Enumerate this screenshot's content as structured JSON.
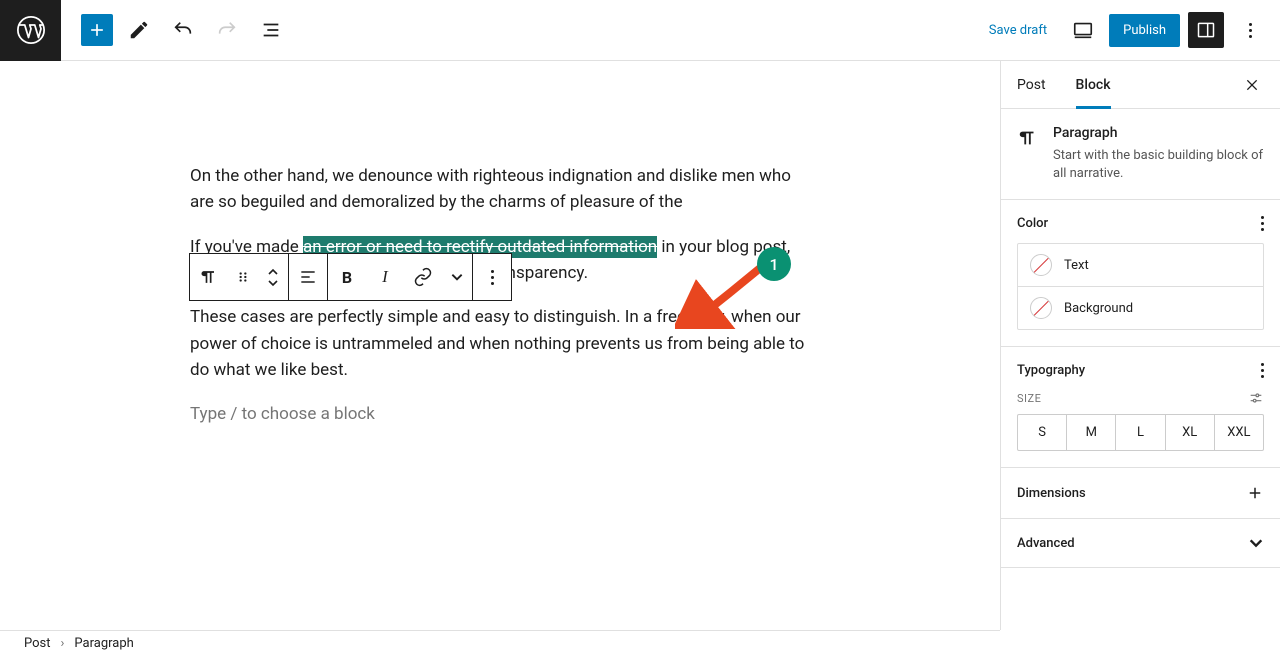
{
  "header": {
    "save_draft": "Save draft",
    "publish": "Publish"
  },
  "block_toolbar": {
    "bold": "B",
    "italic": "I"
  },
  "content": {
    "p1": "On the other hand, we denounce with righteous indignation and dislike men who are so beguiled and demoralized by the charms of pleasure of the",
    "p2_a": "If you've made ",
    "p2_sel": "an error or need to rectify outdated information",
    "p2_b": " in your blog post, using strikethrough helps you maintain transparency.",
    "p3": "These cases are perfectly simple and easy to distinguish. In a free hour, when our power of choice is untrammeled and when nothing prevents us from being able to do what we like best.",
    "placeholder": "Type / to choose a block"
  },
  "annotation": {
    "badge": "1"
  },
  "sidebar": {
    "tabs": {
      "post": "Post",
      "block": "Block"
    },
    "block_info": {
      "title": "Paragraph",
      "desc": "Start with the basic building block of all narrative."
    },
    "panels": {
      "color": {
        "title": "Color",
        "text": "Text",
        "background": "Background"
      },
      "typography": {
        "title": "Typography",
        "size_label": "SIZE",
        "sizes": [
          "S",
          "M",
          "L",
          "XL",
          "XXL"
        ]
      },
      "dimensions": "Dimensions",
      "advanced": "Advanced"
    }
  },
  "breadcrumb": {
    "post": "Post",
    "paragraph": "Paragraph"
  }
}
